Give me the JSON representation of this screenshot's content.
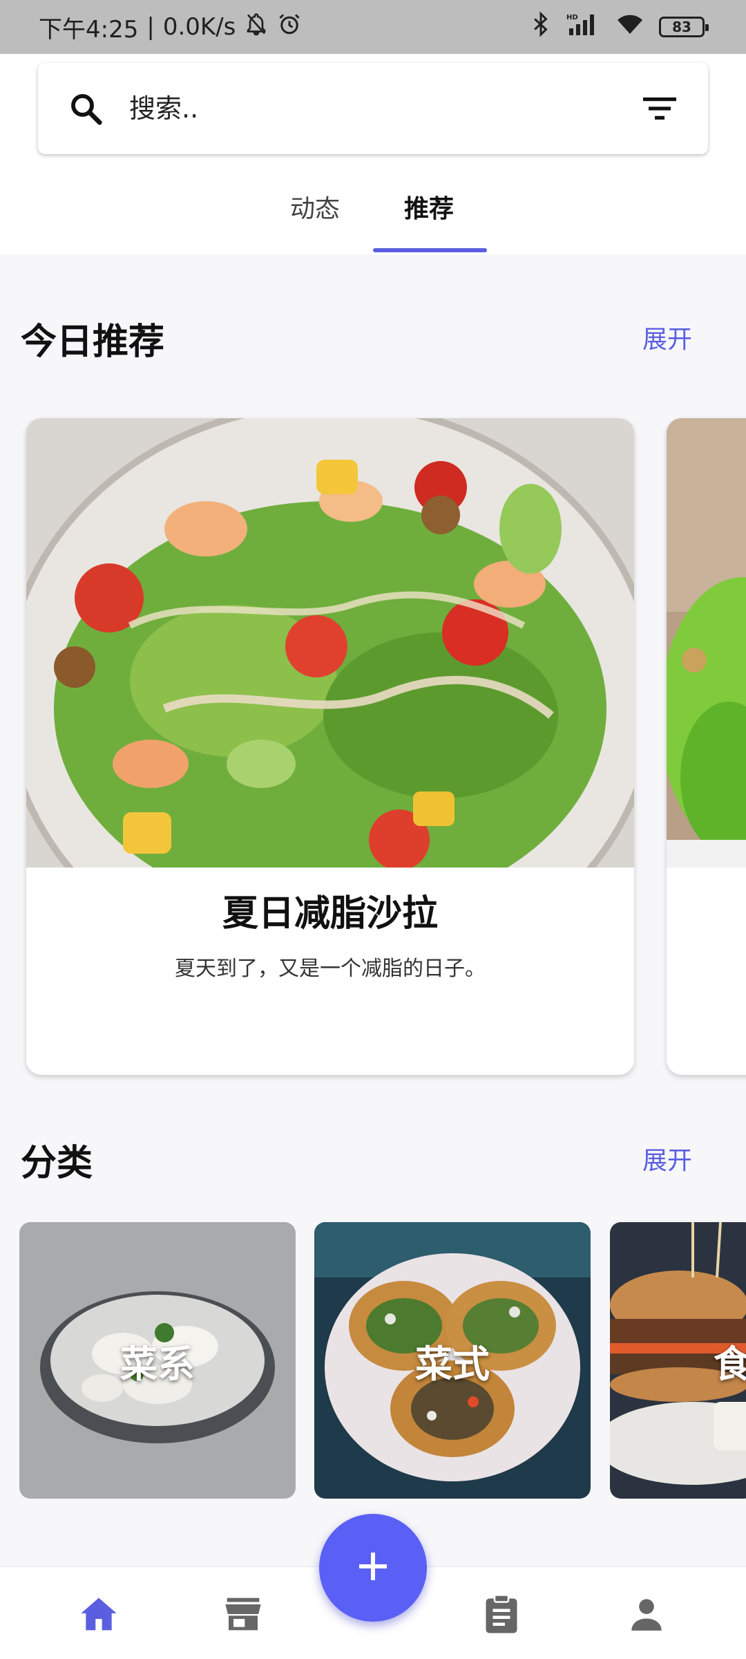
{
  "status_bar": {
    "time": "下午4:25",
    "network_speed": "0.0K/s",
    "battery": "83",
    "icons": [
      "bell-off-icon",
      "alarm-icon",
      "bluetooth-icon",
      "signal-icon",
      "wifi-icon",
      "battery-icon"
    ]
  },
  "search": {
    "placeholder": "搜索..",
    "icons": [
      "search-icon",
      "filter-icon"
    ]
  },
  "tabs": [
    {
      "label": "动态",
      "active": false
    },
    {
      "label": "推荐",
      "active": true
    }
  ],
  "today": {
    "title": "今日推荐",
    "more_label": "展开",
    "cards": [
      {
        "title": "夏日减脂沙拉",
        "description": "夏天到了，又是一个减脂的日子。"
      }
    ]
  },
  "categories": {
    "title": "分类",
    "more_label": "展开",
    "items": [
      {
        "label": "菜系"
      },
      {
        "label": "菜式"
      },
      {
        "label": "食"
      }
    ]
  },
  "bottom_nav": {
    "items": [
      "home-icon",
      "store-icon",
      "add-icon",
      "clipboard-icon",
      "person-icon"
    ],
    "active": "home-icon"
  },
  "colors": {
    "accent": "#5a5fe0",
    "fab": "#5a5ff5",
    "status_bar": "#bdbdbd",
    "page_background": "#f7f7fa"
  }
}
